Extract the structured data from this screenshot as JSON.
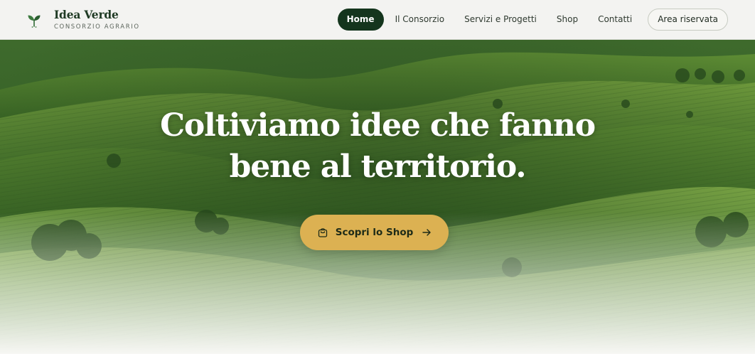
{
  "brand": {
    "name": "Idea Verde",
    "subtitle": "CONSORZIO AGRARIO",
    "logo_icon": "leaf-sprout-icon"
  },
  "nav": {
    "items": [
      {
        "label": "Home",
        "active": true
      },
      {
        "label": "Il Consorzio",
        "active": false
      },
      {
        "label": "Servizi e Progetti",
        "active": false
      },
      {
        "label": "Shop",
        "active": false
      },
      {
        "label": "Contatti",
        "active": false
      }
    ],
    "login_label": "Area riservata"
  },
  "hero": {
    "title_line1": "Coltiviamo idee che fanno",
    "title_line2": "bene al territorio.",
    "cta_label": "Scopri lo Shop",
    "cta_icon": "shopping-bag-icon",
    "cta_arrow_icon": "arrow-right-icon"
  },
  "colors": {
    "brand_dark_green": "#14351d",
    "accent_gold": "#dcb152",
    "header_bg": "#f3f3f1"
  }
}
